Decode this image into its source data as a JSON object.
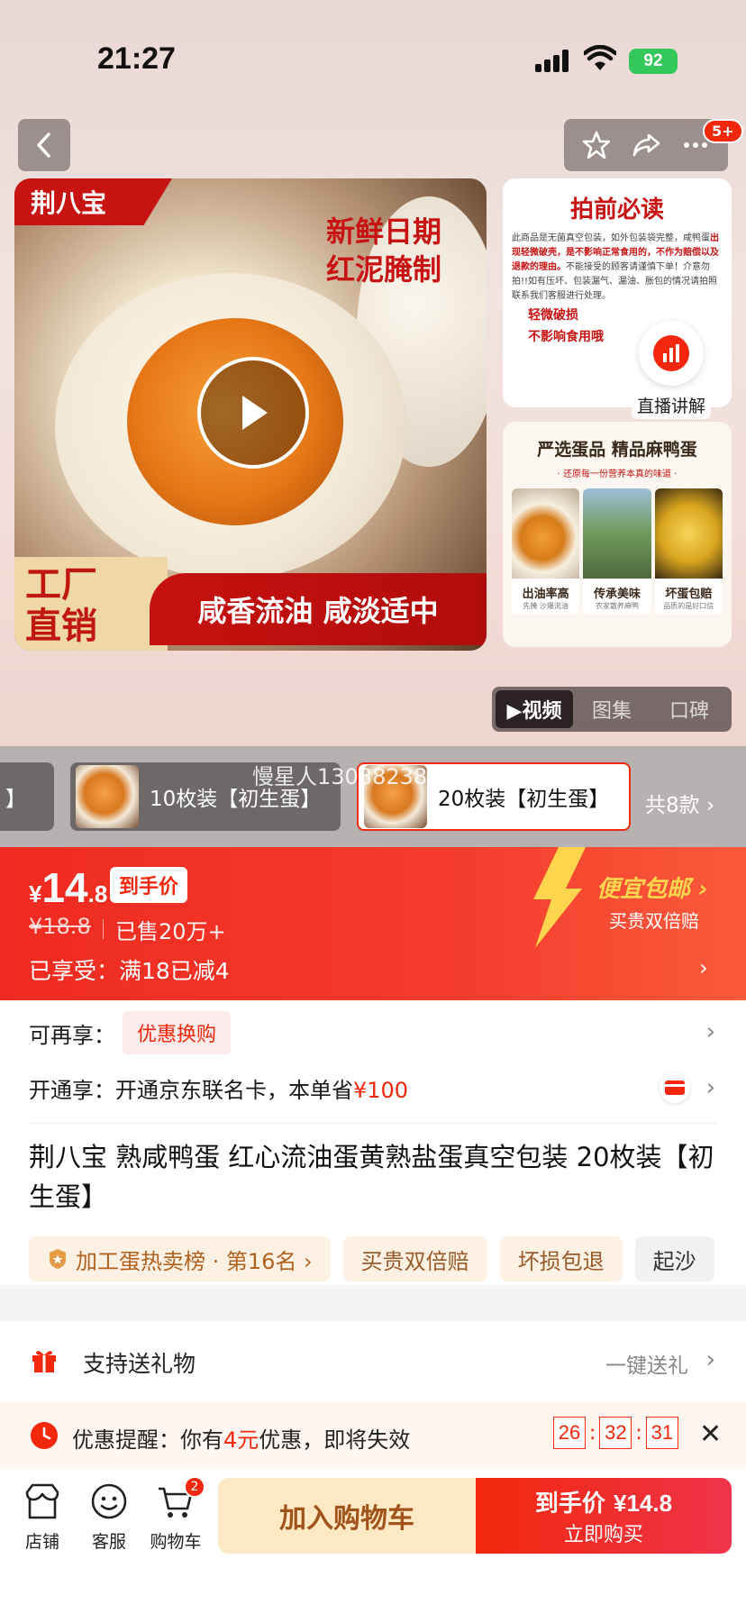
{
  "status": {
    "time": "21:27",
    "battery": "92"
  },
  "nav": {
    "more_badge": "5+"
  },
  "media": {
    "brand": "荆八宝",
    "fresh_line1": "新鲜日期",
    "fresh_line2": "红泥腌制",
    "factory_line1": "工厂",
    "factory_line2": "直销",
    "banner": "咸香流油 咸淡适中",
    "side_top_title": "拍前必读",
    "side_top_text": "此商品是无菌真空包装，如外包装袋完整，咸鸭蛋",
    "side_top_text_red": "出现轻微破壳，是不影响正常食用的，不作为赔偿以及退款的理由。",
    "side_top_text2": "不能接受的顾客请谨慎下单！介意勿拍!!如有压坏、包装漏气、漏油、胀包的情况请拍照联系我们客服进行处理。",
    "side_top_minor1": "轻微破损",
    "side_top_minor2": "不影响食用哦",
    "live_label": "直播讲解",
    "side_bot_title": "严选蛋品 精品麻鸭蛋",
    "side_bot_sub": "· 还原每一份营养本真的味道 ·",
    "tiles": [
      {
        "cap": "出油率高",
        "cap2": "先腌 沙爆流油"
      },
      {
        "cap": "传承美味",
        "cap2": "农家散养麻鸭"
      },
      {
        "cap": "坏蛋包赔",
        "cap2": "品质的是好口信"
      }
    ],
    "tabs": [
      "▶视频",
      "图集",
      "口碑"
    ]
  },
  "variants": {
    "items": [
      "】",
      "10枚装【初生蛋】",
      "20枚装【初生蛋】"
    ],
    "total": "共8款 ›",
    "watermark": "慢星人13088238"
  },
  "price": {
    "currency": "¥",
    "int": "14",
    "dec": ".8",
    "final_tag": "到手价",
    "old": "¥18.8",
    "sold": "已售20万+",
    "discount": "已享受：满18已减4",
    "cheap_ship": "便宜包邮 ›",
    "double_comp": "买贵双倍赔",
    "chevron": "›"
  },
  "info": {
    "more_label": "可再享：",
    "more_pill": "优惠换购",
    "card_label": "开通享：开通京东联名卡，本单省",
    "card_amount": "¥100",
    "title": "荆八宝 熟咸鸭蛋 红心流油蛋黄熟盐蛋真空包装 20枚装【初生蛋】",
    "chips": [
      "加工蛋热卖榜 · 第16名 ›",
      "买贵双倍赔",
      "坏损包退",
      "起沙"
    ]
  },
  "gift": {
    "label": "支持送礼物",
    "action": "一键送礼",
    "chevron": "›"
  },
  "remind": {
    "prefix": "优惠提醒：你有",
    "amount": "4元",
    "suffix": "优惠，即将失效",
    "timer": [
      "26",
      "32",
      "31"
    ]
  },
  "bottom": {
    "shop": "店铺",
    "service": "客服",
    "cart": "购物车",
    "cart_count": "2",
    "add_cart": "加入购物车",
    "buy_price_label": "到手价",
    "buy_price": "¥14.8",
    "buy_now": "立即购买"
  },
  "colors": {
    "accent": "#f2270c",
    "cart_bg": "#ffe8c4"
  }
}
